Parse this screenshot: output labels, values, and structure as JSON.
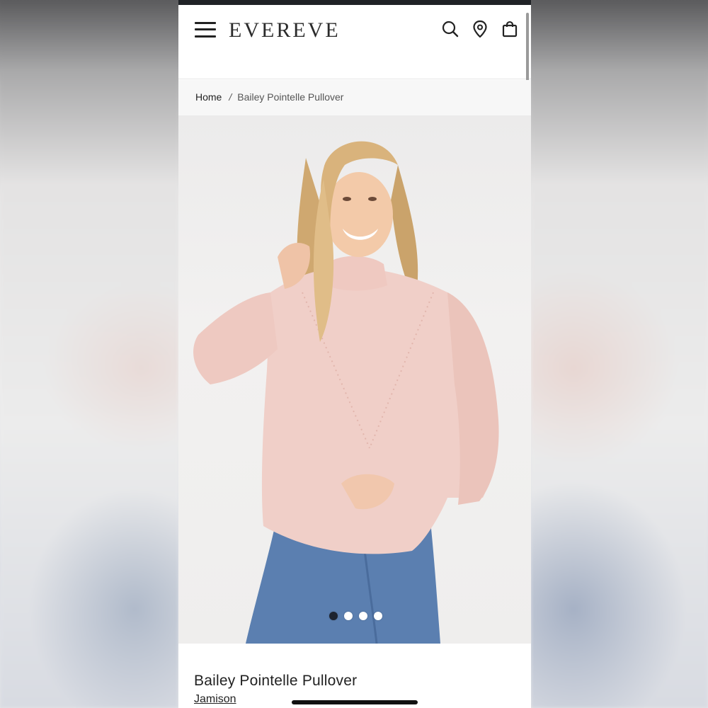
{
  "header": {
    "logo_text": "EVEREVE",
    "menu_icon": "hamburger-menu-icon",
    "search_icon": "search-icon",
    "location_icon": "map-pin-icon",
    "bag_icon": "shopping-bag-icon"
  },
  "breadcrumb": {
    "home": "Home",
    "separator": "/",
    "current": "Bailey Pointelle Pullover"
  },
  "gallery": {
    "total_images": 4,
    "active_index": 0
  },
  "product": {
    "title": "Bailey Pointelle Pullover",
    "brand": "Jamison"
  },
  "colors": {
    "status_bar": "#1f2226",
    "text": "#222222",
    "sweater": "#f0cfc8",
    "denim": "#5b7fb0"
  }
}
